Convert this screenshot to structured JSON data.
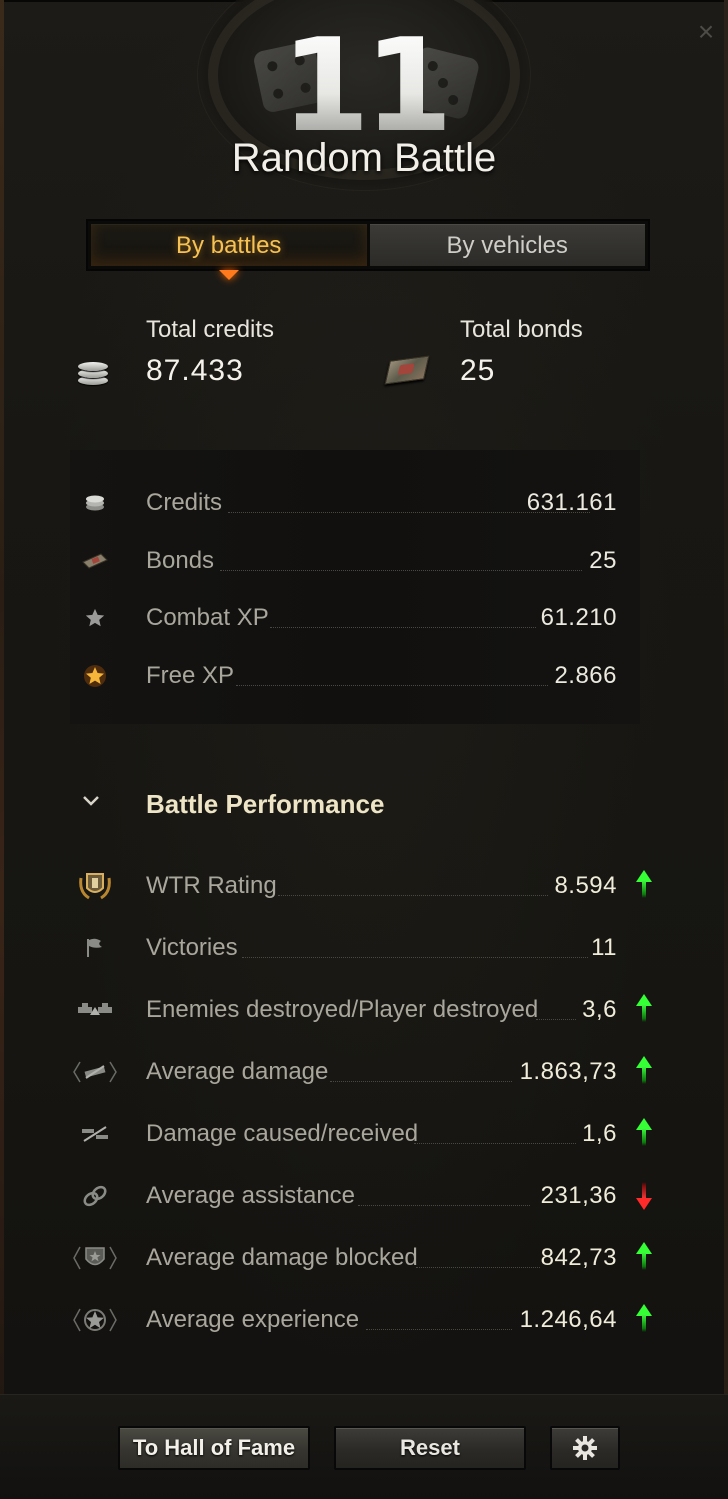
{
  "header": {
    "battle_count": "11",
    "title": "Random Battle",
    "close_glyph": "×"
  },
  "tabs": [
    {
      "label": "By battles",
      "active": true
    },
    {
      "label": "By vehicles",
      "active": false
    }
  ],
  "totals": {
    "credits": {
      "label": "Total credits",
      "value": "87.433",
      "icon": "credits-icon"
    },
    "bonds": {
      "label": "Total bonds",
      "value": "25",
      "icon": "bonds-icon"
    }
  },
  "earnings": [
    {
      "label": "Credits",
      "value": "631.161",
      "icon": "credits-icon"
    },
    {
      "label": "Bonds",
      "value": "25",
      "icon": "bonds-icon"
    },
    {
      "label": "Combat XP",
      "value": "61.210",
      "icon": "star-icon"
    },
    {
      "label": "Free XP",
      "value": "2.866",
      "icon": "gold-star-icon"
    }
  ],
  "performance": {
    "title": "Battle Performance",
    "rows": [
      {
        "label": "WTR Rating",
        "value": "8.594",
        "trend": "up",
        "icon": "wtr-rating-icon"
      },
      {
        "label": "Victories",
        "value": "11",
        "trend": "none",
        "icon": "flag-icon"
      },
      {
        "label": "Enemies destroyed/Player destroyed",
        "value": "3,6",
        "trend": "up",
        "icon": "tanks-destroyed-icon"
      },
      {
        "label": "Average damage",
        "value": "1.863,73",
        "trend": "up",
        "icon": "damage-icon"
      },
      {
        "label": "Damage caused/received",
        "value": "1,6",
        "trend": "up",
        "icon": "damage-ratio-icon"
      },
      {
        "label": "Average assistance",
        "value": "231,36",
        "trend": "down",
        "icon": "assistance-icon"
      },
      {
        "label": "Average damage blocked",
        "value": "842,73",
        "trend": "up",
        "icon": "shield-icon"
      },
      {
        "label": "Average experience",
        "value": "1.246,64",
        "trend": "up",
        "icon": "experience-icon"
      }
    ]
  },
  "footer": {
    "hall_of_fame_label": "To Hall of Fame",
    "reset_label": "Reset",
    "settings_icon": "gear-icon"
  },
  "colors": {
    "active_tab": "#f7c253",
    "trend_up": "#35ff35",
    "trend_down": "#ff2b2b",
    "background": "#181713"
  }
}
